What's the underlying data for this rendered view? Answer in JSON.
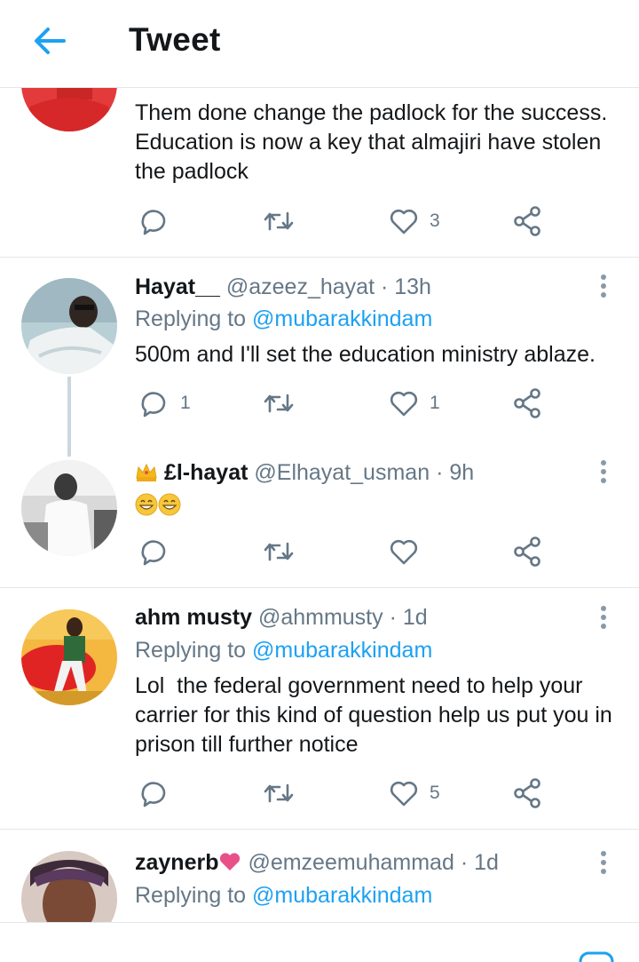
{
  "header": {
    "title": "Tweet"
  },
  "tweets": [
    {
      "text": "Them done change the padlock for the success. Education is now a key that almajiri have stolen the padlock",
      "actions": {
        "reply": "",
        "retweet": "",
        "like": "3"
      }
    },
    {
      "name": "Hayat__",
      "handle": "@azeez_hayat",
      "time": "· 13h",
      "replying_prefix": "Replying to",
      "replying_to": "@mubarakkindam",
      "text": "500m and I'll set the education ministry ablaze.",
      "actions": {
        "reply": "1",
        "retweet": "",
        "like": "1"
      }
    },
    {
      "name": "£l-hayat",
      "handle": "@Elhayat_usman",
      "time": "· 9h",
      "text": "😁😁",
      "actions": {
        "reply": "",
        "retweet": "",
        "like": ""
      }
    },
    {
      "name": "ahm musty",
      "handle": "@ahmmusty",
      "time": "· 1d",
      "replying_prefix": "Replying to",
      "replying_to": "@mubarakkindam",
      "text": "Lol  the federal government need to help your carrier for this kind of question help us put you in prison till further notice",
      "actions": {
        "reply": "",
        "retweet": "",
        "like": "5"
      }
    },
    {
      "name": "zaynerb",
      "handle": "@emzeemuhammad",
      "time": "· 1d",
      "replying_prefix": "Replying to",
      "replying_to": "@mubarakkindam"
    }
  ],
  "icons": {
    "back": "arrow-left-icon",
    "reply": "comment-icon",
    "retweet": "retweet-icon",
    "like": "heart-icon",
    "share": "share-icon",
    "more": "more-vertical-icon"
  },
  "colors": {
    "accent": "#1da1f2",
    "secondary_text": "#657786",
    "icon": "#657786",
    "divider": "#e1e8ed"
  }
}
